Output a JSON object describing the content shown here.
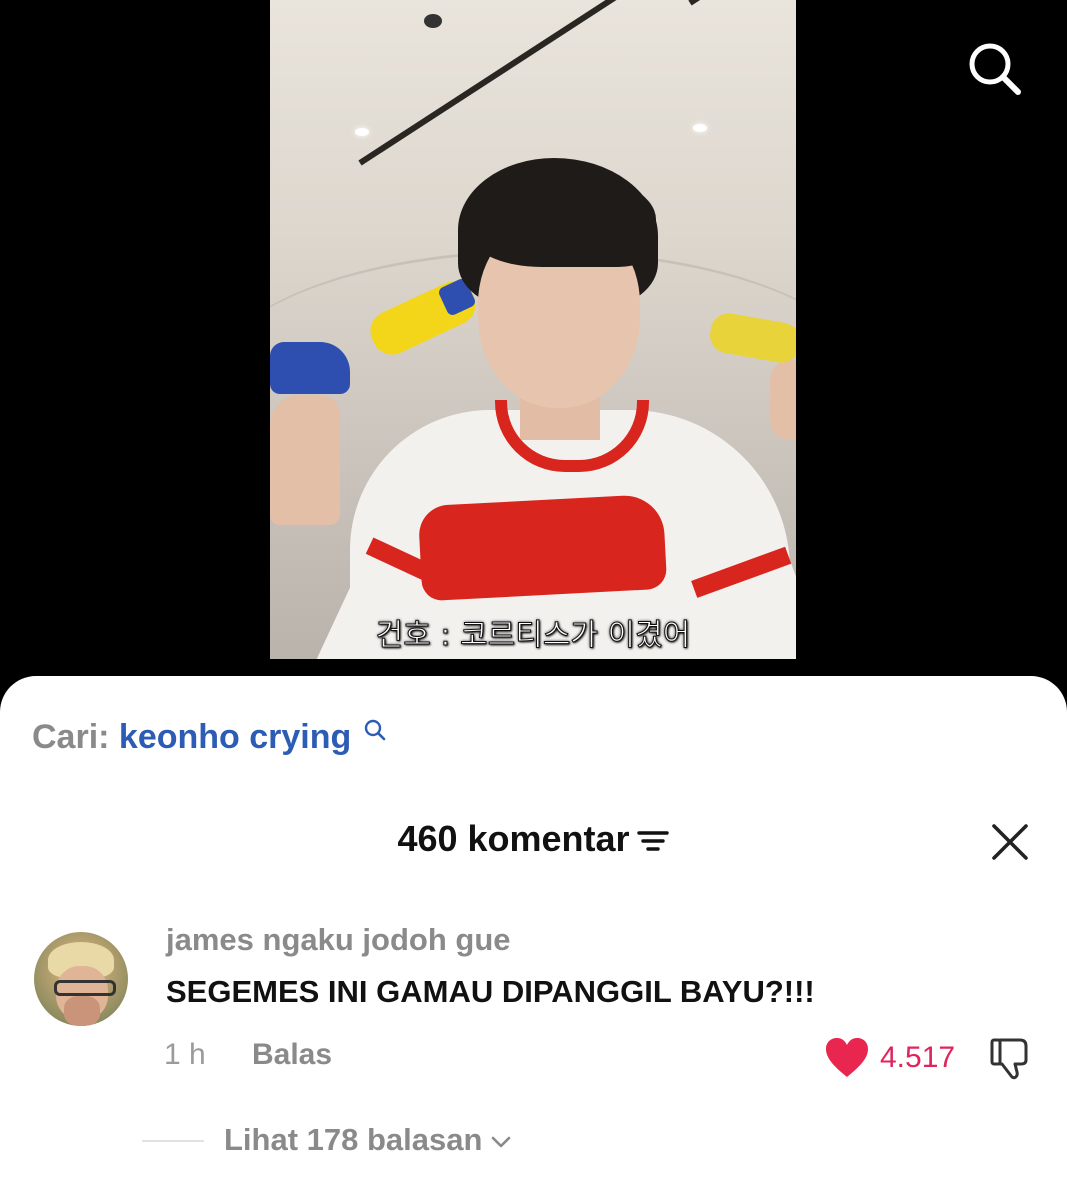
{
  "video": {
    "subtitle": "건호 : 코르티스가 이겼어"
  },
  "search_suggestion": {
    "prefix": "Cari:",
    "query": "keonho crying"
  },
  "comments_panel": {
    "count_label": "460 komentar"
  },
  "comment": {
    "username": "james ngaku jodoh gue",
    "text": "SEGEMES INI GAMAU DIPANGGIL BAYU?!!!",
    "time": "1 h",
    "reply_label": "Balas",
    "like_count": "4.517",
    "view_replies_label": "Lihat 178 balasan"
  },
  "colors": {
    "like_heart": "#e8264f",
    "search_query": "#2c5cb4"
  },
  "icons": [
    "search-icon",
    "sort-icon",
    "close-icon",
    "heart-icon",
    "dislike-icon",
    "chevron-down-icon"
  ]
}
